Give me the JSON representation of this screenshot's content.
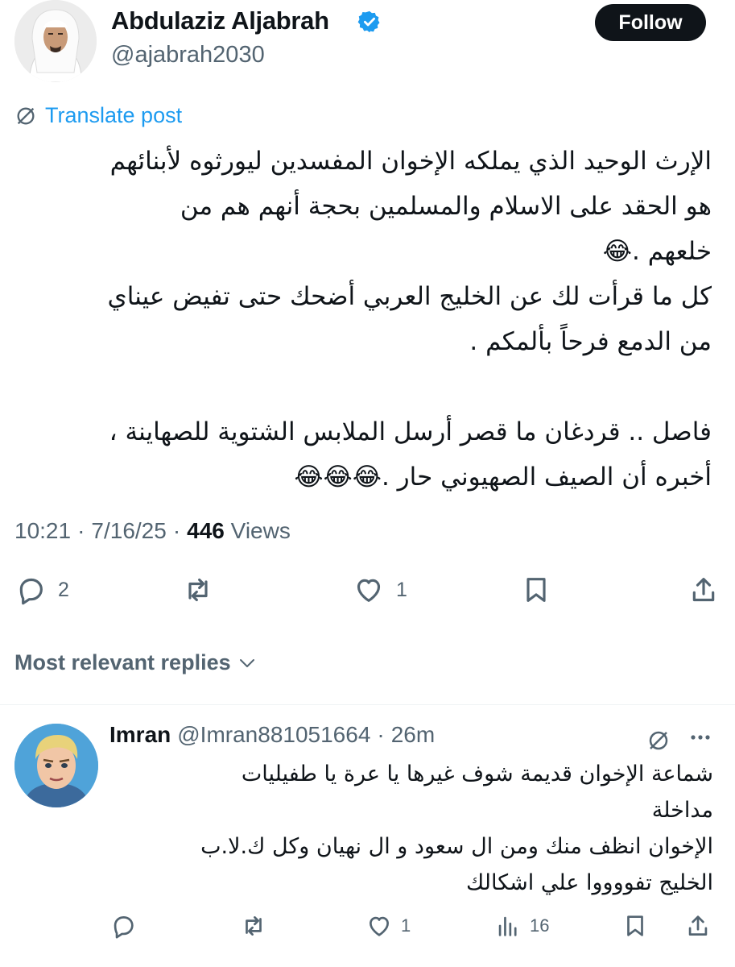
{
  "post": {
    "author_name": "Abdulaziz Aljabrah",
    "author_handle": "@ajabrah2030",
    "follow_label": "Follow",
    "translate_label": "Translate post",
    "lines": [
      "الإرث الوحيد الذي يملكه الإخوان المفسدين ليورثوه لأبنائهم",
      "هو الحقد على الاسلام والمسلمين بحجة أنهم هم من",
      "خلعهم .😂",
      "كل ما قرأت لك عن الخليج العربي أضحك حتى تفيض عيناي",
      "من الدمع فرحاً بألمكم .",
      "",
      "فاصل .. قردغان ما قصر أرسل الملابس الشتوية للصهاينة ،",
      "أخبره أن الصيف الصهيوني حار .😂😂😂"
    ],
    "time": "10:21",
    "date": "7/16/25",
    "views_count": "446",
    "views_label": "Views",
    "reply_count": "2",
    "like_count": "1"
  },
  "replies_header": {
    "label": "Most relevant replies"
  },
  "reply": {
    "name": "Imran",
    "handle": "@Imran881051664",
    "time": "26m",
    "lines": [
      "شماعة الإخوان  قديمة شوف غيرها يا عرة يا طفيليات",
      "مداخلة",
      "الإخوان انظف منك  ومن ال سعود و ال نهيان وكل ك.لا.ب",
      "الخليج  تفووووا علي اشكالك"
    ],
    "like_count": "1",
    "views_count": "16"
  },
  "icons": {
    "verified": "verified-badge-icon",
    "translate": "translate-globe-icon",
    "reply": "reply-bubble-icon",
    "repost": "repost-icon",
    "like": "heart-icon",
    "bookmark": "bookmark-icon",
    "share": "share-icon",
    "views": "views-bar-icon",
    "more": "more-dots-icon",
    "chevron": "chevron-down-icon"
  },
  "colors": {
    "accent": "#1d9bf0",
    "text": "#0f1419",
    "muted": "#536471"
  }
}
